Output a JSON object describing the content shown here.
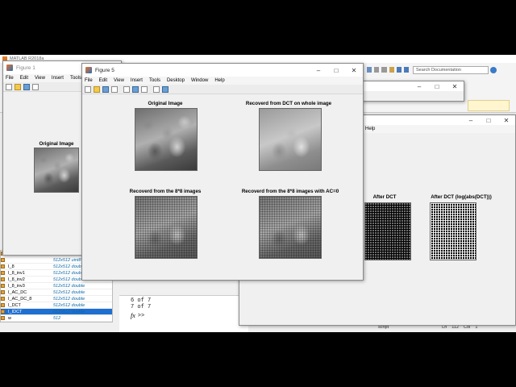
{
  "matlab": {
    "title": "MATLAB R2018a",
    "search_placeholder": "Search Documentation"
  },
  "figure1": {
    "title": "Figure 1",
    "menu": [
      "File",
      "Edit",
      "View",
      "Insert",
      "Tools"
    ],
    "axis_title": "Original Image"
  },
  "figure5": {
    "title": "Figure 5",
    "menu": [
      "File",
      "Edit",
      "View",
      "Insert",
      "Tools",
      "Desktop",
      "Window",
      "Help"
    ],
    "titles": {
      "top_left": "Original Image",
      "top_right": "Recoverd from DCT on whole image",
      "bottom_left": "Recoverd from the 8*8 images",
      "bottom_right": "Recoverd from the 8*8 images with AC=0"
    }
  },
  "figure_back": {
    "menu_help": "Help",
    "titles": {
      "left": "After DCT",
      "right": "After DCT (log(abs(DCT)))"
    }
  },
  "workspace": {
    "rows": [
      {
        "name": "k",
        "value": "512"
      },
      {
        "name": "",
        "value": "512x512 uint8"
      },
      {
        "name": "I_8",
        "value": "512x512 double"
      },
      {
        "name": "I_8_inv1",
        "value": "512x512 double"
      },
      {
        "name": "I_8_inv2",
        "value": "512x512 double"
      },
      {
        "name": "I_8_inv3",
        "value": "512x512 double"
      },
      {
        "name": "I_AC_DC",
        "value": "512x512 double"
      },
      {
        "name": "I_AC_DC_8",
        "value": "512x512 double"
      },
      {
        "name": "I_DCT",
        "value": "512x512 double"
      },
      {
        "name": "I_IDCT",
        "value": "512x512 double"
      },
      {
        "name": "w",
        "value": "512"
      }
    ]
  },
  "command": {
    "lines": [
      "6 of 7",
      "7 of 7"
    ],
    "prompt": ">>",
    "fx": "fx"
  },
  "statusbar": {
    "left": "script",
    "ln_label": "Ln",
    "ln": "112",
    "col_label": "Col",
    "col": "1"
  }
}
